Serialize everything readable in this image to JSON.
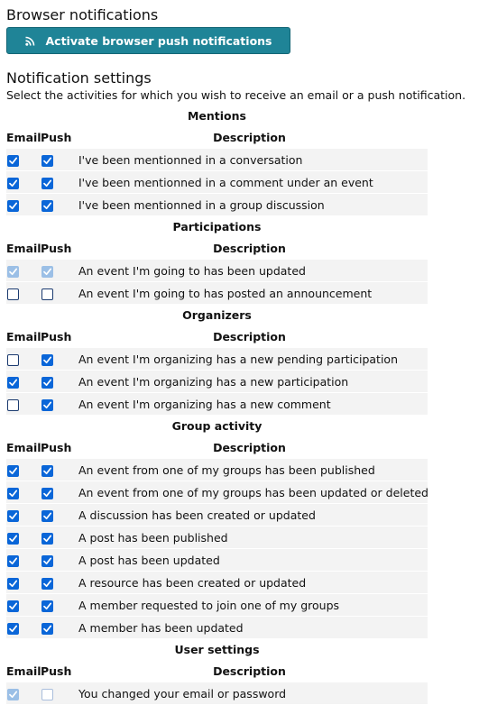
{
  "browser": {
    "heading": "Browser notifications",
    "button_label": "Activate browser push notifications",
    "button_icon": "rss-icon"
  },
  "settings": {
    "heading": "Notification settings",
    "intro": "Select the activities for which you wish to receive an email or a push notification.",
    "col_email": "Email",
    "col_push": "Push",
    "col_desc": "Description",
    "sections": [
      {
        "title": "Mentions",
        "rows": [
          {
            "email": "checked",
            "push": "checked",
            "label": "I've been mentionned in a conversation"
          },
          {
            "email": "checked",
            "push": "checked",
            "label": "I've been mentionned in a comment under an event"
          },
          {
            "email": "checked",
            "push": "checked",
            "label": "I've been mentionned in a group discussion"
          }
        ]
      },
      {
        "title": "Participations",
        "rows": [
          {
            "email": "disabled-checked",
            "push": "disabled-checked",
            "label": "An event I'm going to has been updated"
          },
          {
            "email": "unchecked",
            "push": "unchecked",
            "label": "An event I'm going to has posted an announcement"
          }
        ]
      },
      {
        "title": "Organizers",
        "rows": [
          {
            "email": "unchecked",
            "push": "checked",
            "label": "An event I'm organizing has a new pending participation"
          },
          {
            "email": "checked",
            "push": "checked",
            "label": "An event I'm organizing has a new participation"
          },
          {
            "email": "unchecked",
            "push": "checked",
            "label": "An event I'm organizing has a new comment"
          }
        ]
      },
      {
        "title": "Group activity",
        "rows": [
          {
            "email": "checked",
            "push": "checked",
            "label": "An event from one of my groups has been published"
          },
          {
            "email": "checked",
            "push": "checked",
            "label": "An event from one of my groups has been updated or deleted"
          },
          {
            "email": "checked",
            "push": "checked",
            "label": "A discussion has been created or updated"
          },
          {
            "email": "checked",
            "push": "checked",
            "label": "A post has been published"
          },
          {
            "email": "checked",
            "push": "checked",
            "label": "A post has been updated"
          },
          {
            "email": "checked",
            "push": "checked",
            "label": "A resource has been created or updated"
          },
          {
            "email": "checked",
            "push": "checked",
            "label": "A member requested to join one of my groups"
          },
          {
            "email": "checked",
            "push": "checked",
            "label": "A member has been updated"
          }
        ]
      },
      {
        "title": "User settings",
        "rows": [
          {
            "email": "disabled-checked",
            "push": "disabled-unchecked",
            "label": "You changed your email or password"
          }
        ]
      }
    ]
  },
  "colors": {
    "accent": "#1f8497",
    "checkbox": "#0a66d8",
    "row_bg": "#f3f3f3"
  }
}
